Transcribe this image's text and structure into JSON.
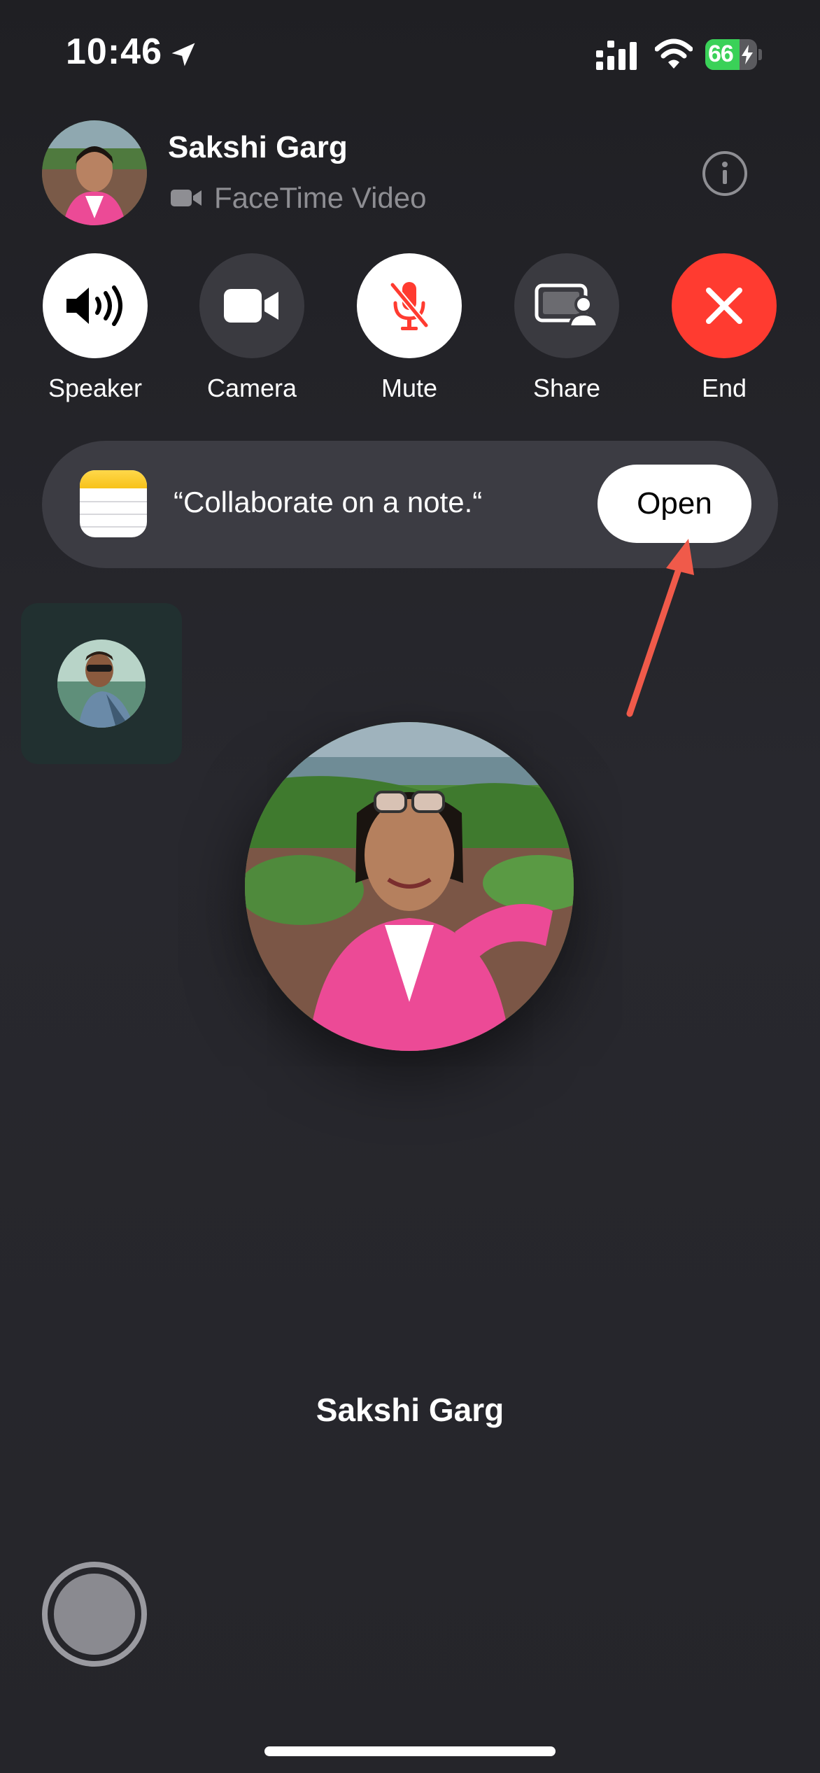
{
  "status_bar": {
    "time": "10:46",
    "battery_level": "66",
    "battery_fraction": 0.66
  },
  "caller": {
    "name": "Sakshi Garg",
    "call_type": "FaceTime Video",
    "call_type_icon": "video-camera-icon",
    "info_icon": "info-icon"
  },
  "controls": [
    {
      "label": "Speaker",
      "icon": "speaker-icon"
    },
    {
      "label": "Camera",
      "icon": "camera-icon"
    },
    {
      "label": "Mute",
      "icon": "mic-muted-icon"
    },
    {
      "label": "Share",
      "icon": "screen-share-icon"
    },
    {
      "label": "End",
      "icon": "close-icon"
    }
  ],
  "banner": {
    "app_icon": "notes-icon",
    "message": "“Collaborate on a note.“",
    "button_label": "Open"
  },
  "remote": {
    "name": "Sakshi Garg"
  },
  "colors": {
    "end_red": "#ff3b30",
    "mute_icon_red": "#ff3b30",
    "annotation_arrow": "#f05a4a",
    "battery_green": "#3ad158"
  }
}
